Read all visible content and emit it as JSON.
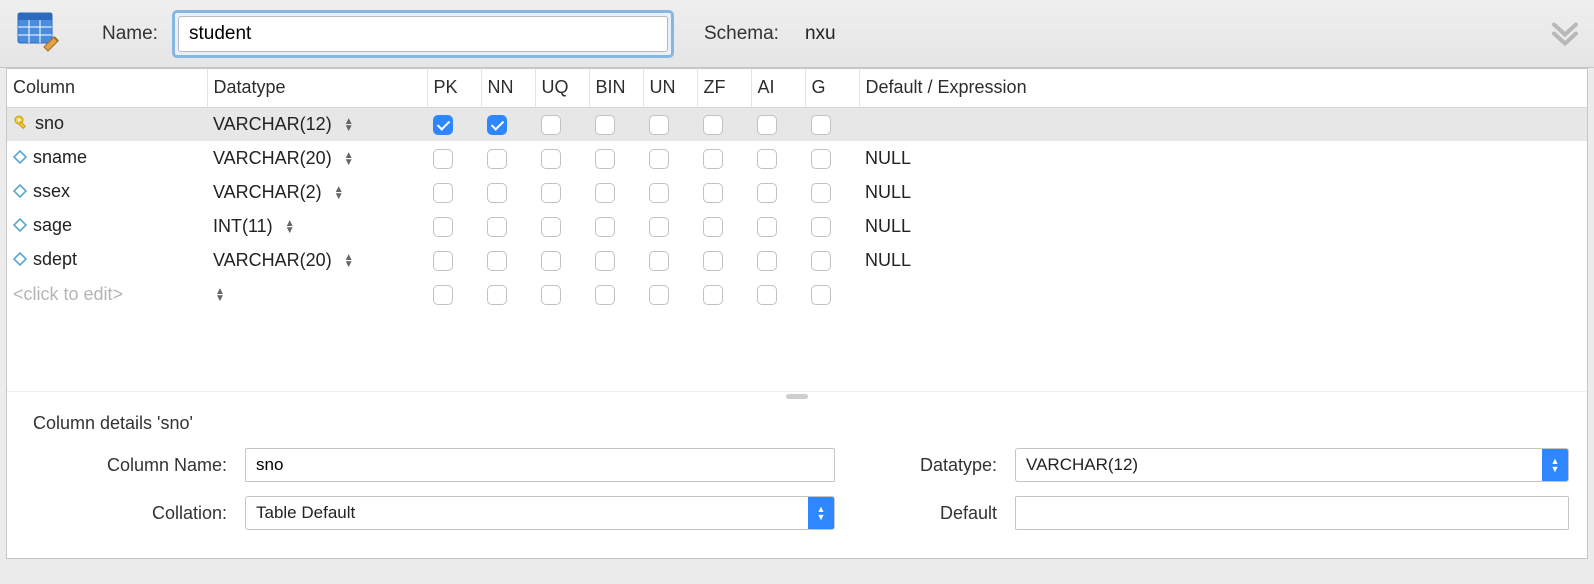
{
  "header": {
    "name_label": "Name:",
    "name_value": "student",
    "schema_label": "Schema:",
    "schema_value": "nxu"
  },
  "grid": {
    "headers": {
      "column": "Column",
      "datatype": "Datatype",
      "pk": "PK",
      "nn": "NN",
      "uq": "UQ",
      "bin": "BIN",
      "un": "UN",
      "zf": "ZF",
      "ai": "AI",
      "g": "G",
      "default": "Default / Expression"
    },
    "rows": [
      {
        "icon": "key",
        "name": "sno",
        "datatype": "VARCHAR(12)",
        "pk": true,
        "nn": true,
        "uq": false,
        "bin": false,
        "un": false,
        "zf": false,
        "ai": false,
        "g": false,
        "default": "",
        "selected": true
      },
      {
        "icon": "diamond",
        "name": "sname",
        "datatype": "VARCHAR(20)",
        "pk": false,
        "nn": false,
        "uq": false,
        "bin": false,
        "un": false,
        "zf": false,
        "ai": false,
        "g": false,
        "default": "NULL",
        "selected": false
      },
      {
        "icon": "diamond",
        "name": "ssex",
        "datatype": "VARCHAR(2)",
        "pk": false,
        "nn": false,
        "uq": false,
        "bin": false,
        "un": false,
        "zf": false,
        "ai": false,
        "g": false,
        "default": "NULL",
        "selected": false
      },
      {
        "icon": "diamond",
        "name": "sage",
        "datatype": "INT(11)",
        "pk": false,
        "nn": false,
        "uq": false,
        "bin": false,
        "un": false,
        "zf": false,
        "ai": false,
        "g": false,
        "default": "NULL",
        "selected": false
      },
      {
        "icon": "diamond",
        "name": "sdept",
        "datatype": "VARCHAR(20)",
        "pk": false,
        "nn": false,
        "uq": false,
        "bin": false,
        "un": false,
        "zf": false,
        "ai": false,
        "g": false,
        "default": "NULL",
        "selected": false
      }
    ],
    "placeholder_text": "<click to edit>"
  },
  "details": {
    "title": "Column details 'sno'",
    "column_name_label": "Column Name:",
    "column_name_value": "sno",
    "datatype_label": "Datatype:",
    "datatype_value": "VARCHAR(12)",
    "collation_label": "Collation:",
    "collation_value": "Table Default",
    "default_label": "Default",
    "default_value": ""
  }
}
